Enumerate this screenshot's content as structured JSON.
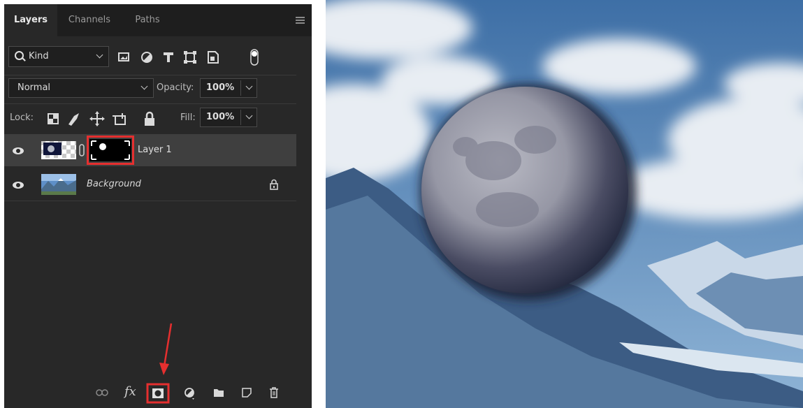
{
  "tabs": [
    "Layers",
    "Channels",
    "Paths"
  ],
  "filter": {
    "kind_label": "Kind"
  },
  "blend": {
    "mode": "Normal",
    "opacity_label": "Opacity:",
    "opacity_value": "100%"
  },
  "lock": {
    "label": "Lock:",
    "fill_label": "Fill:",
    "fill_value": "100%"
  },
  "layers": [
    {
      "name": "Layer 1",
      "selected": true
    },
    {
      "name": "Background",
      "locked": true
    }
  ],
  "bottom_toolbar": [
    "link-icon",
    "fx-icon",
    "add-mask-icon",
    "adjustment-icon",
    "folder-icon",
    "new-layer-icon",
    "trash-icon"
  ],
  "bottom_toolbar_labels": {
    "fx": "fx"
  },
  "colors": {
    "panel": "#282828",
    "highlight": "#e52f2f",
    "selected_row": "#3f3f3f"
  }
}
